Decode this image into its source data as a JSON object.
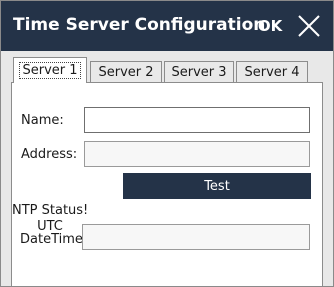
{
  "window": {
    "title": "Time Server Configuration",
    "ok_label": "OK",
    "close_icon": "close-icon"
  },
  "tabs": [
    {
      "label": "Server 1",
      "active": true
    },
    {
      "label": "Server 2",
      "active": false
    },
    {
      "label": "Server 3",
      "active": false
    },
    {
      "label": "Server 4",
      "active": false
    }
  ],
  "form": {
    "name_label": "Name:",
    "name_value": "",
    "address_label": "Address:",
    "address_value": "",
    "test_label": "Test",
    "ntp_status_label": "NTP Status!",
    "utc_label_line1": "UTC",
    "utc_label_line2": "DateTime:",
    "utc_value": ""
  },
  "colors": {
    "titlebar": "#243348",
    "button": "#243348"
  }
}
